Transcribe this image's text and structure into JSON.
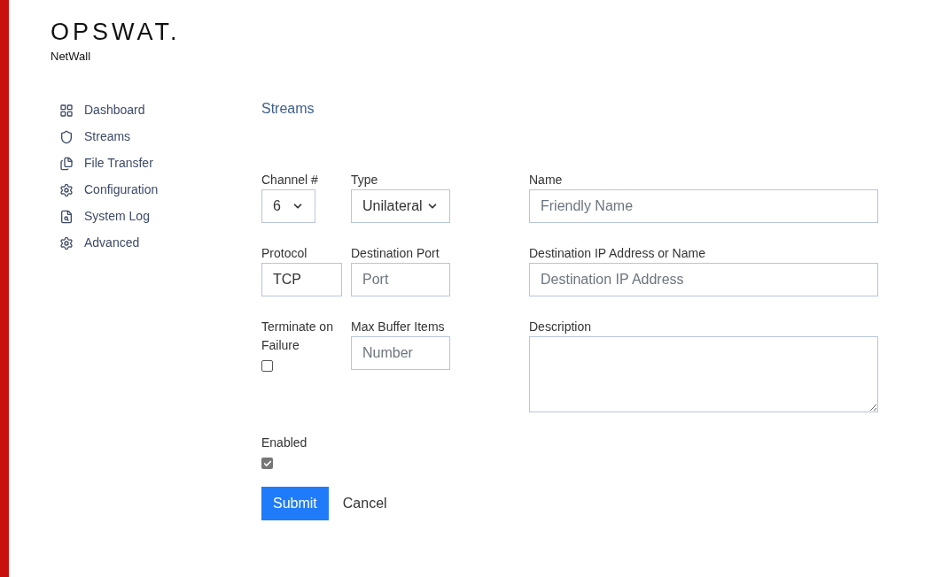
{
  "brand": {
    "logo": "OPSWAT.",
    "product": "NetWall"
  },
  "sidebar": {
    "items": [
      {
        "label": "Dashboard",
        "selected": false
      },
      {
        "label": "Streams",
        "selected": false
      },
      {
        "label": "File Transfer",
        "selected": false
      },
      {
        "label": "Configuration",
        "selected": false
      },
      {
        "label": "System Log",
        "selected": false
      },
      {
        "label": "Advanced",
        "selected": false
      }
    ]
  },
  "page": {
    "title": "Streams"
  },
  "form": {
    "rows": [
      [
        {
          "kind": "select",
          "label": "Channel #",
          "value": "6"
        },
        {
          "kind": "select",
          "label": "Type",
          "value": "Unilateral"
        },
        {
          "kind": "input",
          "label": "Name",
          "placeholder": "Friendly Name"
        }
      ],
      [
        {
          "kind": "input",
          "label": "Protocol",
          "value": "TCP"
        },
        {
          "kind": "input",
          "label": "Destination Port",
          "placeholder": "Port"
        },
        {
          "kind": "input",
          "label": "Destination IP Address or Name",
          "placeholder": "Destination IP Address"
        }
      ],
      [
        {
          "kind": "checkbox",
          "label": "Terminate on Failure",
          "checked": false
        },
        {
          "kind": "input",
          "label": "Max Buffer Items",
          "placeholder": "Number"
        },
        {
          "kind": "textarea",
          "label": "Description"
        }
      ],
      [
        {
          "kind": "checkbox",
          "label": "Enabled",
          "checked": true
        }
      ]
    ]
  },
  "buttons": {
    "submit": "Submit",
    "cancel": "Cancel"
  }
}
